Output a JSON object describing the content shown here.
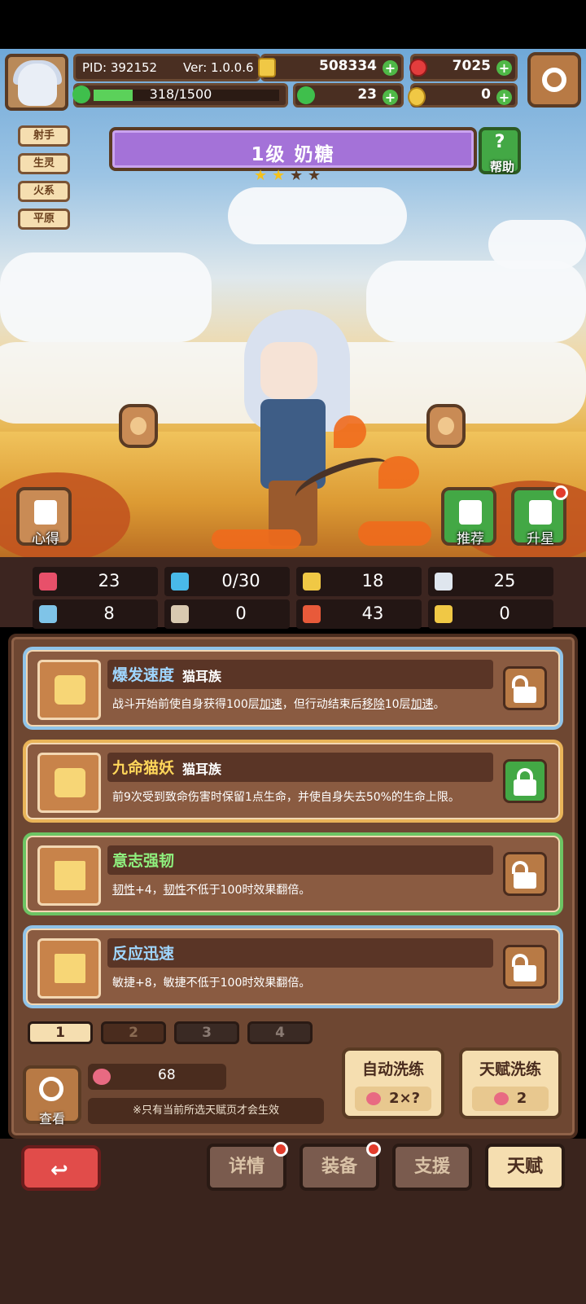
{
  "header": {
    "pid": "PID: 392152",
    "version": "Ver: 1.0.0.6",
    "coins": "508334",
    "gems": "7025",
    "xp_text": "318/1500",
    "xp_progress": 0.21,
    "clovers": "23",
    "tickets": "0"
  },
  "tags": [
    "射手",
    "生灵",
    "火系",
    "平原"
  ],
  "hero": {
    "title": "1级 奶糖",
    "stars_filled": 2,
    "stars_total": 4,
    "help_label": "帮助"
  },
  "side_buttons": {
    "notes": "心得",
    "recommend": "推荐",
    "star_up": "升星"
  },
  "stats": [
    {
      "icon": "heart-icon",
      "value": "23",
      "color": "#e8506a"
    },
    {
      "icon": "mana-drop-icon",
      "value": "0/30",
      "color": "#49b9e8"
    },
    {
      "icon": "shield-icon",
      "value": "18",
      "color": "#f0c845"
    },
    {
      "icon": "wing-icon",
      "value": "25",
      "color": "#dfe6ee"
    },
    {
      "icon": "fist-icon",
      "value": "8",
      "color": "#7fc4e8"
    },
    {
      "icon": "book-icon",
      "value": "0",
      "color": "#d9c9b0"
    },
    {
      "icon": "armor-icon",
      "value": "43",
      "color": "#e85a3a"
    },
    {
      "icon": "horseshoe-icon",
      "value": "0",
      "color": "#f0c845"
    }
  ],
  "talents": [
    {
      "name": "爆发速度",
      "tribe": "猫耳族",
      "desc_parts": [
        "战斗开始前使自身获得100层",
        "加速",
        "，但行动结束后",
        "移除",
        "10层",
        "加速",
        "。"
      ],
      "border": "#8fc3e8",
      "name_color": "#9fd6ff",
      "lock": "unlocked-brown"
    },
    {
      "name": "九命猫妖",
      "tribe": "猫耳族",
      "desc_parts": [
        "前9次受到致命伤害时保留1点生命，并使自身失去50%的生命上限。"
      ],
      "border": "#e9b458",
      "name_color": "#ffd65a",
      "lock": "locked-green"
    },
    {
      "name": "意志强韧",
      "tribe": "",
      "desc_parts": [
        "韧性",
        "+4，",
        "韧性",
        "不低于100时效果翻倍。"
      ],
      "border": "#6cc463",
      "name_color": "#8ff07e",
      "lock": "unlocked-brown"
    },
    {
      "name": "反应迅速",
      "tribe": "",
      "desc_parts": [
        "敏捷+8，敏捷不低于100时效果翻倍。"
      ],
      "border": "#8fc3e8",
      "name_color": "#9fd6ff",
      "lock": "unlocked-brown"
    }
  ],
  "pages": [
    "1",
    "2",
    "3",
    "4"
  ],
  "active_page": "1",
  "fruit_count": "68",
  "view_label": "查看",
  "note_text": "※只有当前所选天赋页才会生效",
  "auto_wash": {
    "title": "自动洗练",
    "cost": "2×?"
  },
  "talent_wash": {
    "title": "天赋洗练",
    "cost": "2"
  },
  "nav": {
    "details": "详情",
    "equipment": "装备",
    "support": "支援",
    "talent": "天赋"
  }
}
